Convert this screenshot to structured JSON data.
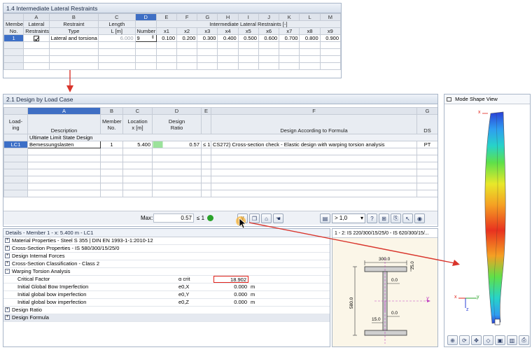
{
  "restraints": {
    "title": "1.4 Intermediate Lateral Restraints",
    "col_letters": [
      "A",
      "B",
      "C",
      "D",
      "E",
      "F",
      "G",
      "H",
      "I",
      "J",
      "K",
      "L",
      "M"
    ],
    "h_member": "Member",
    "h_no": "No.",
    "h_lateral": "Lateral",
    "h_restraints": "Restraints",
    "h_restraint": "Restraint",
    "h_type": "Type",
    "h_length": "Length",
    "h_length_unit": "L [m]",
    "h_number": "Number",
    "h_intermediate": "Intermediate Lateral Restraints [-]",
    "x_labels": [
      "x1",
      "x2",
      "x3",
      "x4",
      "x5",
      "x6",
      "x7",
      "x8",
      "x9"
    ],
    "row": {
      "no": "1",
      "type": "Lateral and torsiona",
      "length": "6.000",
      "number": "9",
      "x": [
        "0.100",
        "0.200",
        "0.300",
        "0.400",
        "0.500",
        "0.600",
        "0.700",
        "0.800",
        "0.900"
      ]
    }
  },
  "design": {
    "title": "2.1 Design by Load Case",
    "col_letters": [
      "A",
      "B",
      "C",
      "D",
      "E",
      "F",
      "G"
    ],
    "h_loading": "Load-\ning",
    "h_description": "Description",
    "h_member": "Member\nNo.",
    "h_location": "Location\nx [m]",
    "h_design_ratio": "Design\nRatio",
    "h_formula": "Design According to Formula",
    "h_ds": "DS",
    "group_label": "Ultimate Limit State Design",
    "row": {
      "loading": "LC1",
      "description": "Bemessungslasten",
      "member": "1",
      "location": "5.400",
      "ratio": "0.57",
      "le1": "≤ 1",
      "formula": "CS272) Cross-section check - Elastic design with warping torsion analysis",
      "ds": "PT"
    },
    "max_label": "Max:",
    "max_value": "0.57",
    "max_le1": "≤ 1",
    "combo_value": "> 1,0"
  },
  "details": {
    "title": "Details - Member 1 - x: 5.400 m - LC1",
    "rows": [
      {
        "label": "Material Properties - Steel S 355 | DIN EN 1993-1-1:2010-12"
      },
      {
        "label": "Cross-Section Properties  -  IS 580/300/15/25/0"
      },
      {
        "label": "Design Internal Forces"
      },
      {
        "label": "Cross-Section Classification - Class 2"
      },
      {
        "label": "Warping Torsion Analysis"
      }
    ],
    "sub_rows": [
      {
        "label": "Critical Factor",
        "symbol": "α crit",
        "value": "18.902",
        "unit": ""
      },
      {
        "label": "Initial Global Bow Imperfection",
        "symbol": "e0,X",
        "value": "0.000",
        "unit": "m"
      },
      {
        "label": "Initial global bow imperfection",
        "symbol": "e0,Y",
        "value": "0.000",
        "unit": "m"
      },
      {
        "label": "Initial global bow imperfection",
        "symbol": "e0,Z",
        "value": "0.000",
        "unit": "m"
      }
    ],
    "after_rows": [
      {
        "label": "Design Ratio"
      },
      {
        "label": "Design Formula"
      }
    ]
  },
  "section": {
    "title": "1 - 2: IS 220/300/15/25/0 - IS 620/300/15/...",
    "dim_width": "300.0",
    "dim_flange": "25.0",
    "dim_height": "580.0",
    "dim_web": "15.0",
    "dim_zero1": "0.0",
    "dim_zero2": "0.0",
    "axis_y": "y"
  },
  "mode_shape": {
    "title": "Mode Shape View",
    "axis_x": "x",
    "axis_y": "y",
    "axis_z": "z"
  },
  "colors": {
    "panel_border": "#a9b6c8",
    "header_bg": "#e8ecf2",
    "selection": "#3c6fc7",
    "red_arrow": "#d9342b",
    "highlight_box": "#e2231a"
  }
}
